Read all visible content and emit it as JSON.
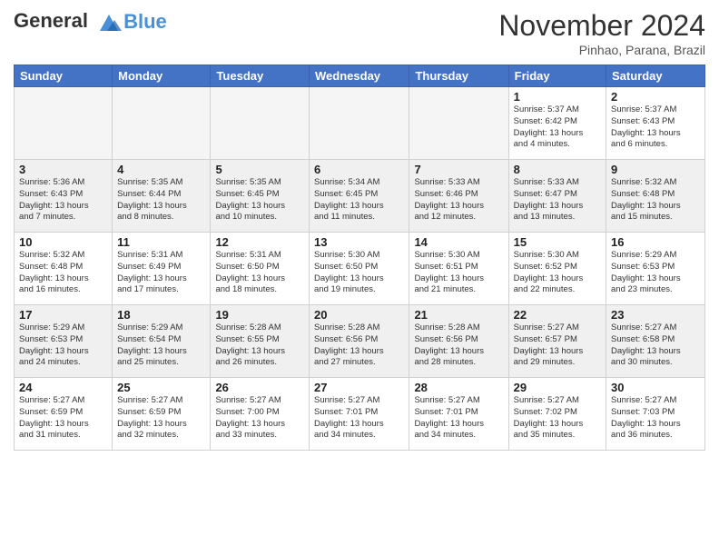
{
  "header": {
    "logo_general": "General",
    "logo_blue": "Blue",
    "month_title": "November 2024",
    "subtitle": "Pinhao, Parana, Brazil"
  },
  "weekdays": [
    "Sunday",
    "Monday",
    "Tuesday",
    "Wednesday",
    "Thursday",
    "Friday",
    "Saturday"
  ],
  "weeks": [
    [
      {
        "day": "",
        "info": ""
      },
      {
        "day": "",
        "info": ""
      },
      {
        "day": "",
        "info": ""
      },
      {
        "day": "",
        "info": ""
      },
      {
        "day": "",
        "info": ""
      },
      {
        "day": "1",
        "info": "Sunrise: 5:37 AM\nSunset: 6:42 PM\nDaylight: 13 hours\nand 4 minutes."
      },
      {
        "day": "2",
        "info": "Sunrise: 5:37 AM\nSunset: 6:43 PM\nDaylight: 13 hours\nand 6 minutes."
      }
    ],
    [
      {
        "day": "3",
        "info": "Sunrise: 5:36 AM\nSunset: 6:43 PM\nDaylight: 13 hours\nand 7 minutes."
      },
      {
        "day": "4",
        "info": "Sunrise: 5:35 AM\nSunset: 6:44 PM\nDaylight: 13 hours\nand 8 minutes."
      },
      {
        "day": "5",
        "info": "Sunrise: 5:35 AM\nSunset: 6:45 PM\nDaylight: 13 hours\nand 10 minutes."
      },
      {
        "day": "6",
        "info": "Sunrise: 5:34 AM\nSunset: 6:45 PM\nDaylight: 13 hours\nand 11 minutes."
      },
      {
        "day": "7",
        "info": "Sunrise: 5:33 AM\nSunset: 6:46 PM\nDaylight: 13 hours\nand 12 minutes."
      },
      {
        "day": "8",
        "info": "Sunrise: 5:33 AM\nSunset: 6:47 PM\nDaylight: 13 hours\nand 13 minutes."
      },
      {
        "day": "9",
        "info": "Sunrise: 5:32 AM\nSunset: 6:48 PM\nDaylight: 13 hours\nand 15 minutes."
      }
    ],
    [
      {
        "day": "10",
        "info": "Sunrise: 5:32 AM\nSunset: 6:48 PM\nDaylight: 13 hours\nand 16 minutes."
      },
      {
        "day": "11",
        "info": "Sunrise: 5:31 AM\nSunset: 6:49 PM\nDaylight: 13 hours\nand 17 minutes."
      },
      {
        "day": "12",
        "info": "Sunrise: 5:31 AM\nSunset: 6:50 PM\nDaylight: 13 hours\nand 18 minutes."
      },
      {
        "day": "13",
        "info": "Sunrise: 5:30 AM\nSunset: 6:50 PM\nDaylight: 13 hours\nand 19 minutes."
      },
      {
        "day": "14",
        "info": "Sunrise: 5:30 AM\nSunset: 6:51 PM\nDaylight: 13 hours\nand 21 minutes."
      },
      {
        "day": "15",
        "info": "Sunrise: 5:30 AM\nSunset: 6:52 PM\nDaylight: 13 hours\nand 22 minutes."
      },
      {
        "day": "16",
        "info": "Sunrise: 5:29 AM\nSunset: 6:53 PM\nDaylight: 13 hours\nand 23 minutes."
      }
    ],
    [
      {
        "day": "17",
        "info": "Sunrise: 5:29 AM\nSunset: 6:53 PM\nDaylight: 13 hours\nand 24 minutes."
      },
      {
        "day": "18",
        "info": "Sunrise: 5:29 AM\nSunset: 6:54 PM\nDaylight: 13 hours\nand 25 minutes."
      },
      {
        "day": "19",
        "info": "Sunrise: 5:28 AM\nSunset: 6:55 PM\nDaylight: 13 hours\nand 26 minutes."
      },
      {
        "day": "20",
        "info": "Sunrise: 5:28 AM\nSunset: 6:56 PM\nDaylight: 13 hours\nand 27 minutes."
      },
      {
        "day": "21",
        "info": "Sunrise: 5:28 AM\nSunset: 6:56 PM\nDaylight: 13 hours\nand 28 minutes."
      },
      {
        "day": "22",
        "info": "Sunrise: 5:27 AM\nSunset: 6:57 PM\nDaylight: 13 hours\nand 29 minutes."
      },
      {
        "day": "23",
        "info": "Sunrise: 5:27 AM\nSunset: 6:58 PM\nDaylight: 13 hours\nand 30 minutes."
      }
    ],
    [
      {
        "day": "24",
        "info": "Sunrise: 5:27 AM\nSunset: 6:59 PM\nDaylight: 13 hours\nand 31 minutes."
      },
      {
        "day": "25",
        "info": "Sunrise: 5:27 AM\nSunset: 6:59 PM\nDaylight: 13 hours\nand 32 minutes."
      },
      {
        "day": "26",
        "info": "Sunrise: 5:27 AM\nSunset: 7:00 PM\nDaylight: 13 hours\nand 33 minutes."
      },
      {
        "day": "27",
        "info": "Sunrise: 5:27 AM\nSunset: 7:01 PM\nDaylight: 13 hours\nand 34 minutes."
      },
      {
        "day": "28",
        "info": "Sunrise: 5:27 AM\nSunset: 7:01 PM\nDaylight: 13 hours\nand 34 minutes."
      },
      {
        "day": "29",
        "info": "Sunrise: 5:27 AM\nSunset: 7:02 PM\nDaylight: 13 hours\nand 35 minutes."
      },
      {
        "day": "30",
        "info": "Sunrise: 5:27 AM\nSunset: 7:03 PM\nDaylight: 13 hours\nand 36 minutes."
      }
    ]
  ]
}
